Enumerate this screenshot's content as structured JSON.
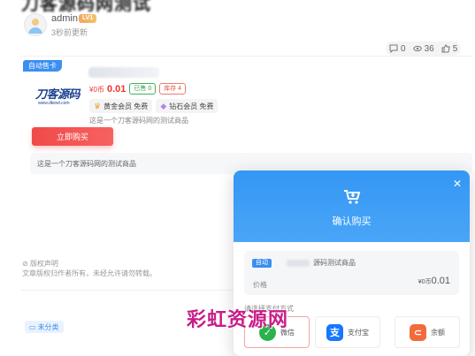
{
  "post": {
    "title": "刀客源码网测试",
    "author": "admin",
    "level_badge": "LV1",
    "updated": "3秒前更新"
  },
  "stats": {
    "comments": "0",
    "views": "36",
    "likes": "5"
  },
  "product": {
    "tag": "自动售卡",
    "logo_main": "刀客源码",
    "logo_sub": "www.dkewl.com",
    "price_symbol": "¥",
    "price_unit": "0币",
    "price_value": "0.01",
    "sold": "已售 0",
    "stock": "库存 4",
    "gold_member": "黄金会员 免费",
    "diamond_member": "钻石会员 免费",
    "desc_short": "这是一个刀客源码网的测试商品",
    "buy_label": "立即购买",
    "desc_full": "这是一个刀客源码网的测试商品"
  },
  "footer": {
    "copyright_title": "版权声明",
    "copyright_text": "文章版权归作者所有，未经允许请勿转载。",
    "category": "未分类"
  },
  "modal": {
    "title": "确认购买",
    "item_tag": "自动",
    "item_name": "源码测试商品",
    "price_label": "价格",
    "price_symbol": "¥",
    "price_unit": "0币",
    "price_value": "0.01",
    "pay_label": "请选择支付方式",
    "pay_wechat": "微信",
    "pay_alipay": "支付宝",
    "pay_balance": "余额"
  },
  "watermark": "彩虹资源网",
  "colors": {
    "accent": "#3b8ff0",
    "price": "#f0342e",
    "buy": "#f04a4a",
    "watermark": "#c81e8a"
  }
}
